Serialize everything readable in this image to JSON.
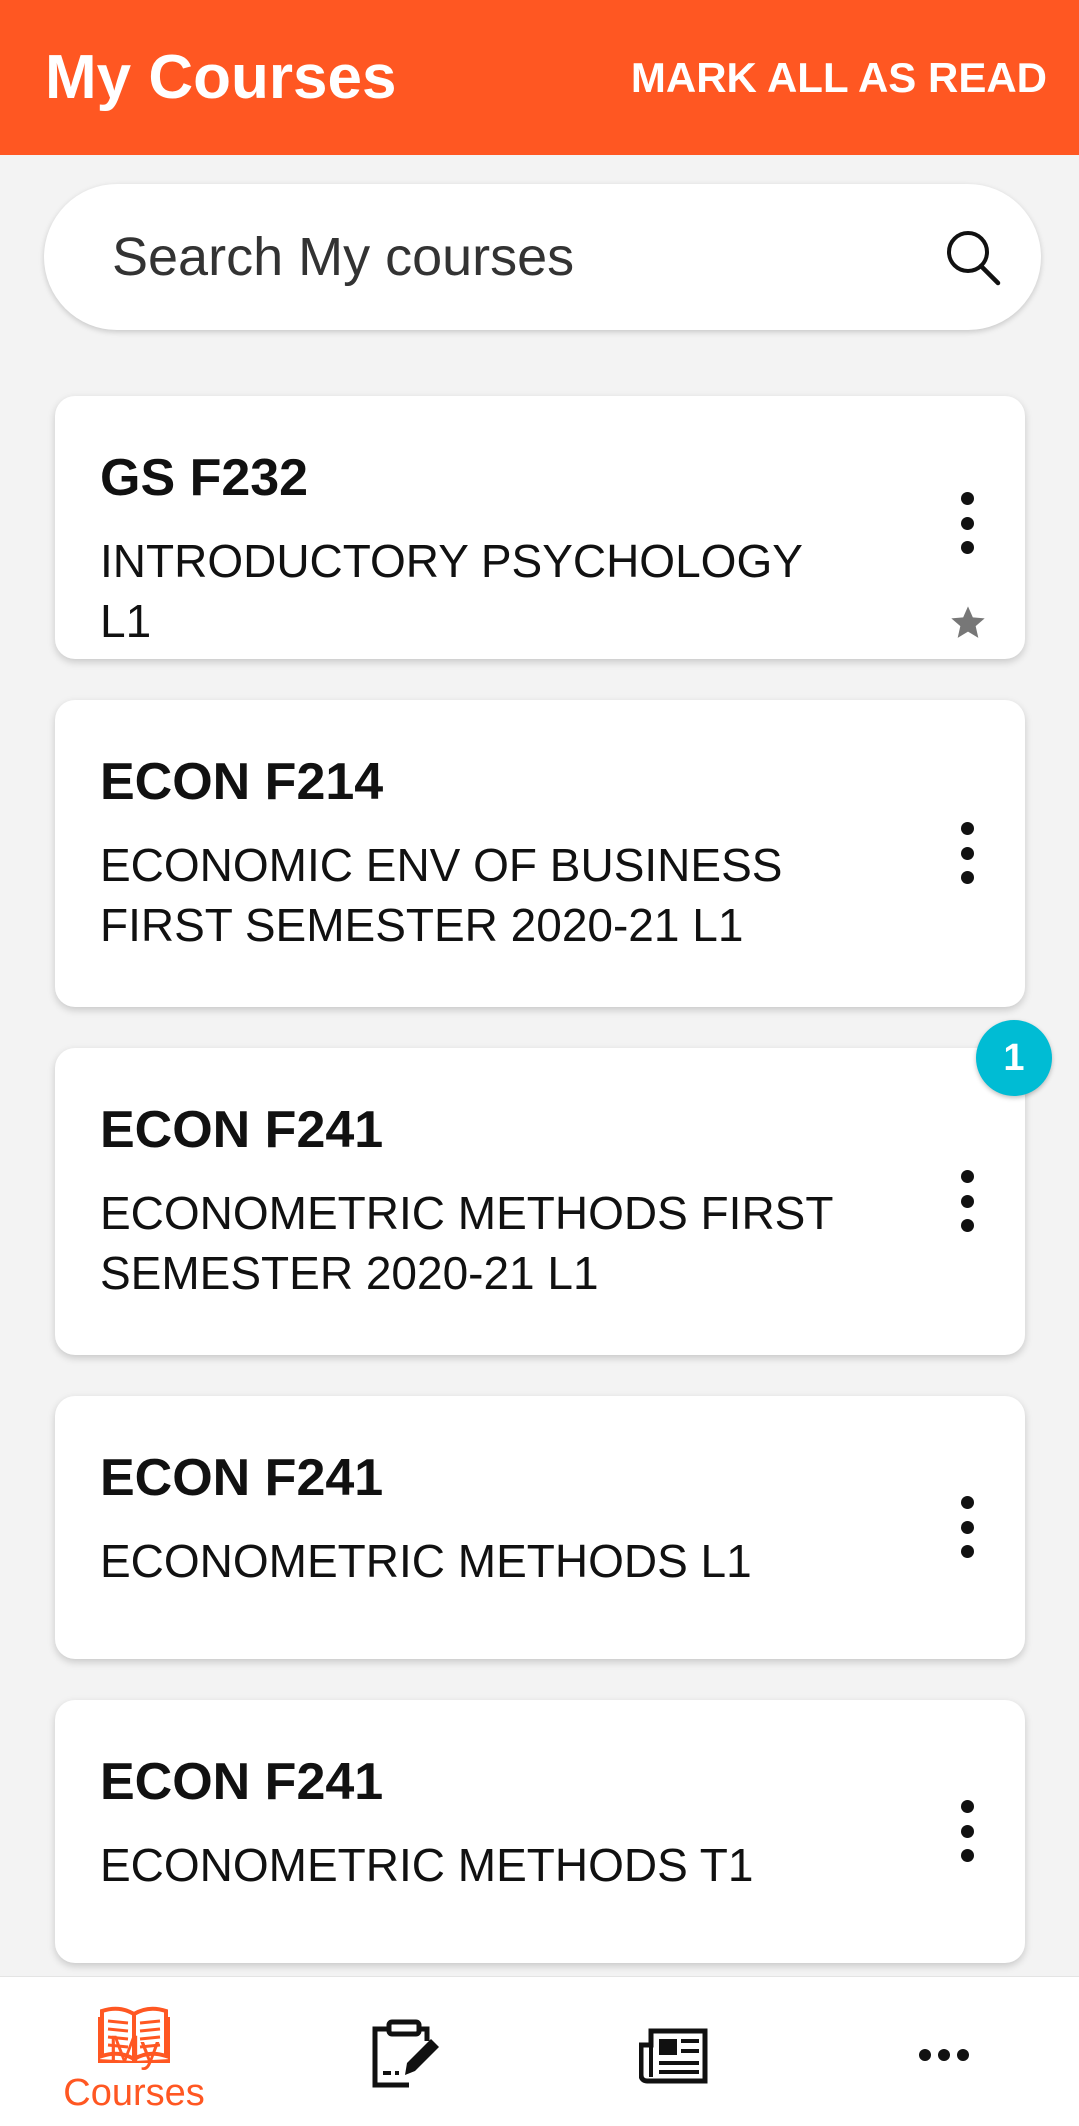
{
  "header": {
    "title": "My Courses",
    "mark_all_label": "MARK ALL AS READ",
    "background": "#ff5722"
  },
  "search": {
    "placeholder": "Search My courses",
    "icon": "search-icon"
  },
  "courses": [
    {
      "code": "GS F232",
      "name": "INTRODUCTORY PSYCHOLOGY L1",
      "starred": true
    },
    {
      "code": "ECON F214",
      "name": "ECONOMIC ENV OF BUSINESS FIRST SEMESTER 2020-21 L1"
    },
    {
      "code": "ECON F241",
      "name": "ECONOMETRIC METHODS FIRST SEMESTER 2020-21 L1",
      "badge": "1"
    },
    {
      "code": "ECON F241",
      "name": "ECONOMETRIC METHODS L1"
    },
    {
      "code": "ECON F241",
      "name": "ECONOMETRIC METHODS T1"
    }
  ],
  "badge_color": "#00bcd4",
  "bottom_nav": {
    "items": [
      {
        "icon": "book-icon",
        "label": "My Courses",
        "active": true
      },
      {
        "icon": "assignment-edit-icon"
      },
      {
        "icon": "newspaper-icon"
      },
      {
        "icon": "more-icon"
      }
    ],
    "active_color": "#ff5722"
  }
}
